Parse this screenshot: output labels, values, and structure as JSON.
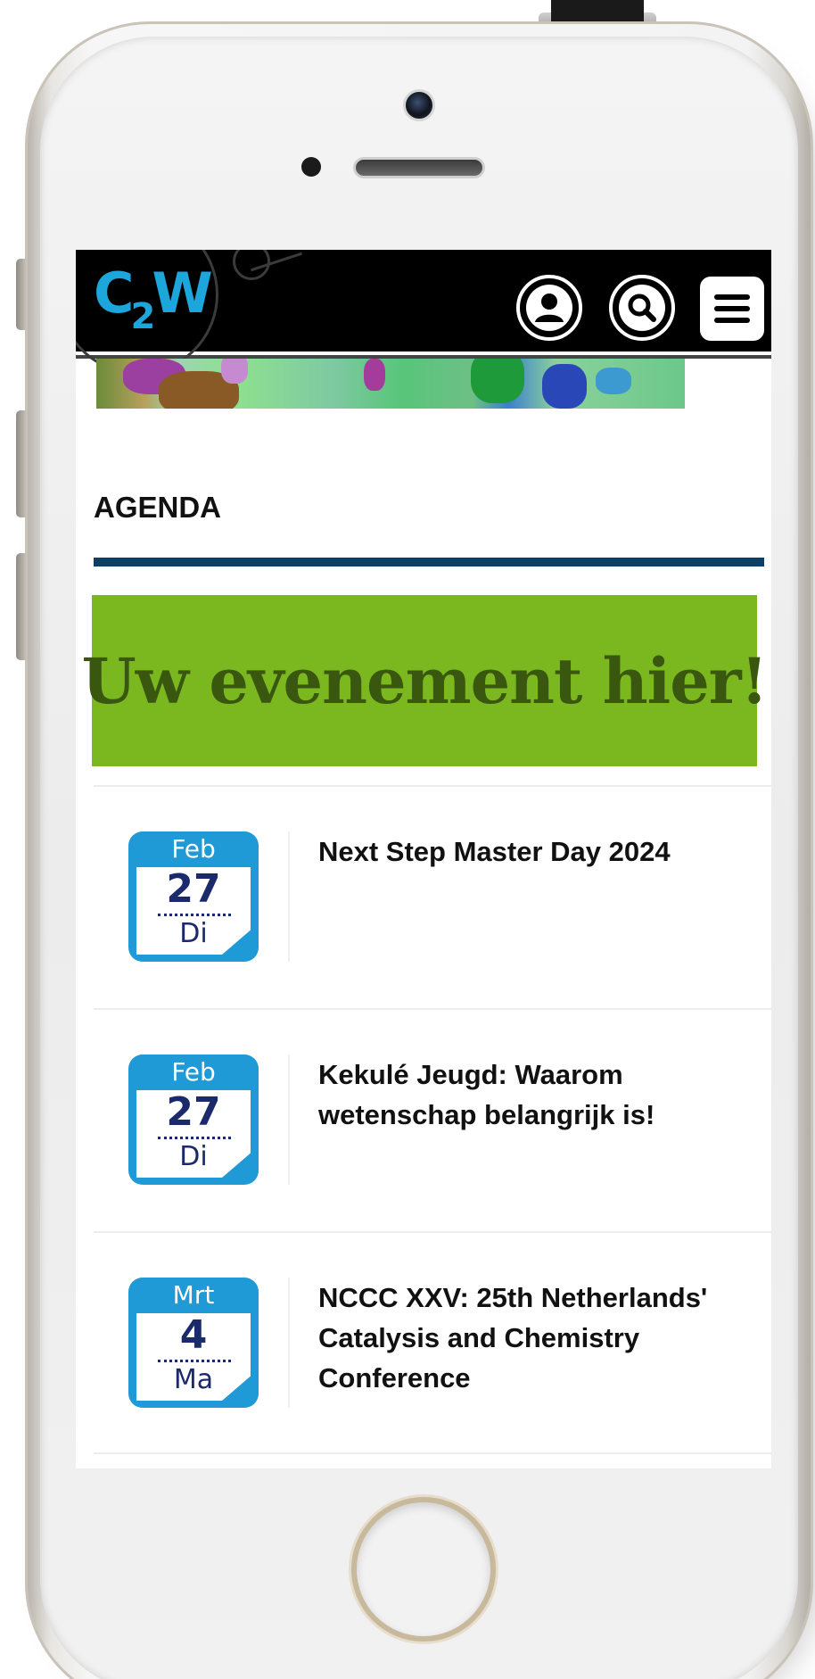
{
  "header": {
    "logo_main": "C",
    "logo_sub": "2",
    "logo_tail": "W",
    "icons": [
      "user-icon",
      "search-icon",
      "menu-icon"
    ]
  },
  "agenda": {
    "title": "AGENDA",
    "promo_text": "Uw evenement hier!",
    "events": [
      {
        "month": "Feb",
        "day": "27",
        "weekday": "Di",
        "title": "Next Step Master Day 2024"
      },
      {
        "month": "Feb",
        "day": "27",
        "weekday": "Di",
        "title": "Kekulé Jeugd: Waarom wetenschap belangrijk is!"
      },
      {
        "month": "Mrt",
        "day": "4",
        "weekday": "Ma",
        "title": "NCCC XXV: 25th Netherlands' Catalysis and Chemistry Conference"
      }
    ]
  },
  "colors": {
    "accent": "#1da6dc",
    "rule": "#0d3f66",
    "promo_bg": "#7bb820",
    "promo_text": "#3a5710",
    "calendar": "#1f9ad6"
  }
}
